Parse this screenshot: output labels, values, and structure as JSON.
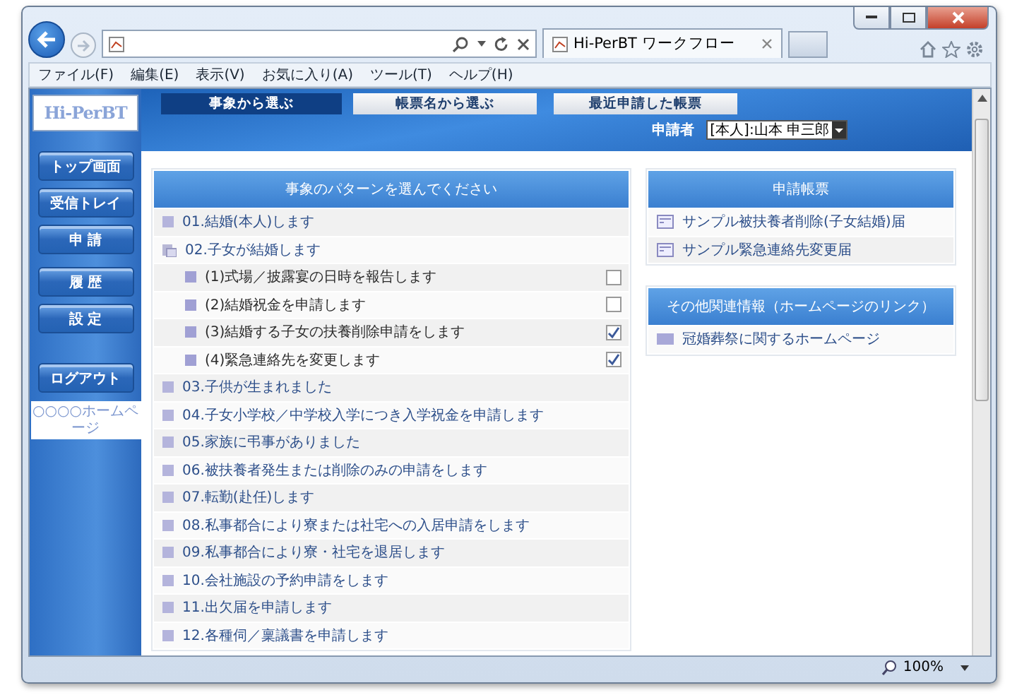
{
  "browser": {
    "tab_title": "Hi-PerBT ワークフロー",
    "menu": [
      "ファイル(F)",
      "編集(E)",
      "表示(V)",
      "お気に入り(A)",
      "ツール(T)",
      "ヘルプ(H)"
    ]
  },
  "app": {
    "logo": "Hi-PerBT",
    "nav_tabs": [
      {
        "label": "事象から選ぶ",
        "selected": true
      },
      {
        "label": "帳票名から選ぶ",
        "selected": false
      },
      {
        "label": "最近申請した帳票",
        "selected": false
      }
    ],
    "applicant_label": "申請者",
    "applicant_value": "[本人]:山本 申三郎"
  },
  "sidebar": {
    "buttons": [
      "トップ画面",
      "受信トレイ",
      "申 請",
      "履 歴",
      "設 定"
    ],
    "logout": "ログアウト",
    "homepage_link": "○○○○ホームページ"
  },
  "patterns": {
    "title": "事象のパターンを選んでください",
    "items": [
      {
        "label": "01.結婚(本人)します",
        "expanded": false
      },
      {
        "label": "02.子女が結婚します",
        "expanded": true,
        "children": [
          {
            "label": "(1)式場／披露宴の日時を報告します",
            "checked": false
          },
          {
            "label": "(2)結婚祝金を申請します",
            "checked": false
          },
          {
            "label": "(3)結婚する子女の扶養削除申請をします",
            "checked": true
          },
          {
            "label": "(4)緊急連絡先を変更します",
            "checked": true
          }
        ]
      },
      {
        "label": "03.子供が生まれました",
        "expanded": false
      },
      {
        "label": "04.子女小学校／中学校入学につき入学祝金を申請します",
        "expanded": false
      },
      {
        "label": "05.家族に弔事がありました",
        "expanded": false
      },
      {
        "label": "06.被扶養者発生または削除のみの申請をします",
        "expanded": false
      },
      {
        "label": "07.転勤(赴任)します",
        "expanded": false
      },
      {
        "label": "08.私事都合により寮または社宅への入居申請をします",
        "expanded": false
      },
      {
        "label": "09.私事都合により寮・社宅を退居します",
        "expanded": false
      },
      {
        "label": "10.会社施設の予約申請をします",
        "expanded": false
      },
      {
        "label": "11.出欠届を申請します",
        "expanded": false
      },
      {
        "label": "12.各種伺／稟議書を申請します",
        "expanded": false
      }
    ]
  },
  "forms": {
    "title": "申請帳票",
    "items": [
      "サンプル被扶養者削除(子女結婚)届",
      "サンプル緊急連絡先変更届"
    ]
  },
  "links": {
    "title": "その他関連情報（ホームページのリンク）",
    "items": [
      "冠婚葬祭に関するホームページ"
    ]
  },
  "status_bar": {
    "zoom": "100%"
  }
}
